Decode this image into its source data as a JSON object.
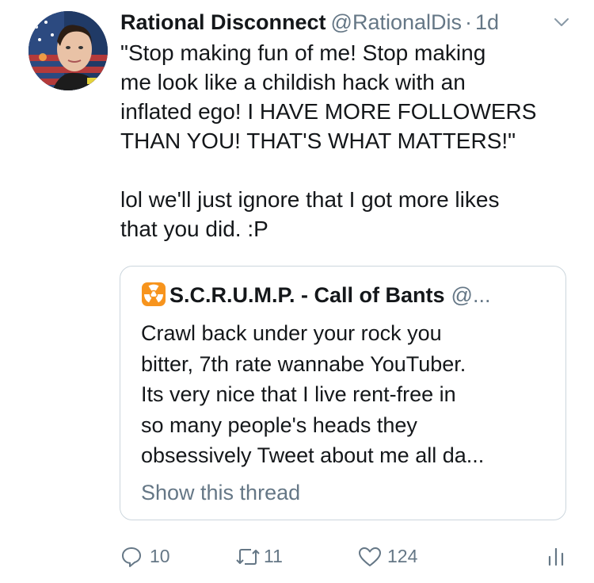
{
  "tweet": {
    "display_name": "Rational Disconnect",
    "handle": "@RationalDis",
    "separator": "·",
    "time": "1d",
    "text": "\"Stop making fun of me! Stop making\nme look like a childish hack with an\ninflated ego! I HAVE MORE FOLLOWERS\nTHAN YOU! THAT'S WHAT MATTERS!\"\n\nlol we'll just ignore that I got more likes\nthat you did. :P"
  },
  "quoted_tweet": {
    "display_name": "S.C.R.U.M.P. - Call of Bants",
    "handle": "@...",
    "icon": "radioactive-icon",
    "text": "Crawl back under your rock you\nbitter, 7th rate wannabe YouTuber.\nIts very nice that I live rent-free in\nso many people's heads they\nobsessively Tweet about me all da...",
    "link": "Show this thread"
  },
  "actions": {
    "replies": "10",
    "retweets": "11",
    "likes": "124"
  },
  "colors": {
    "text": "#14171a",
    "muted": "#657786",
    "border": "#ccd6dd",
    "radioactive_orange": "#f7941d"
  }
}
